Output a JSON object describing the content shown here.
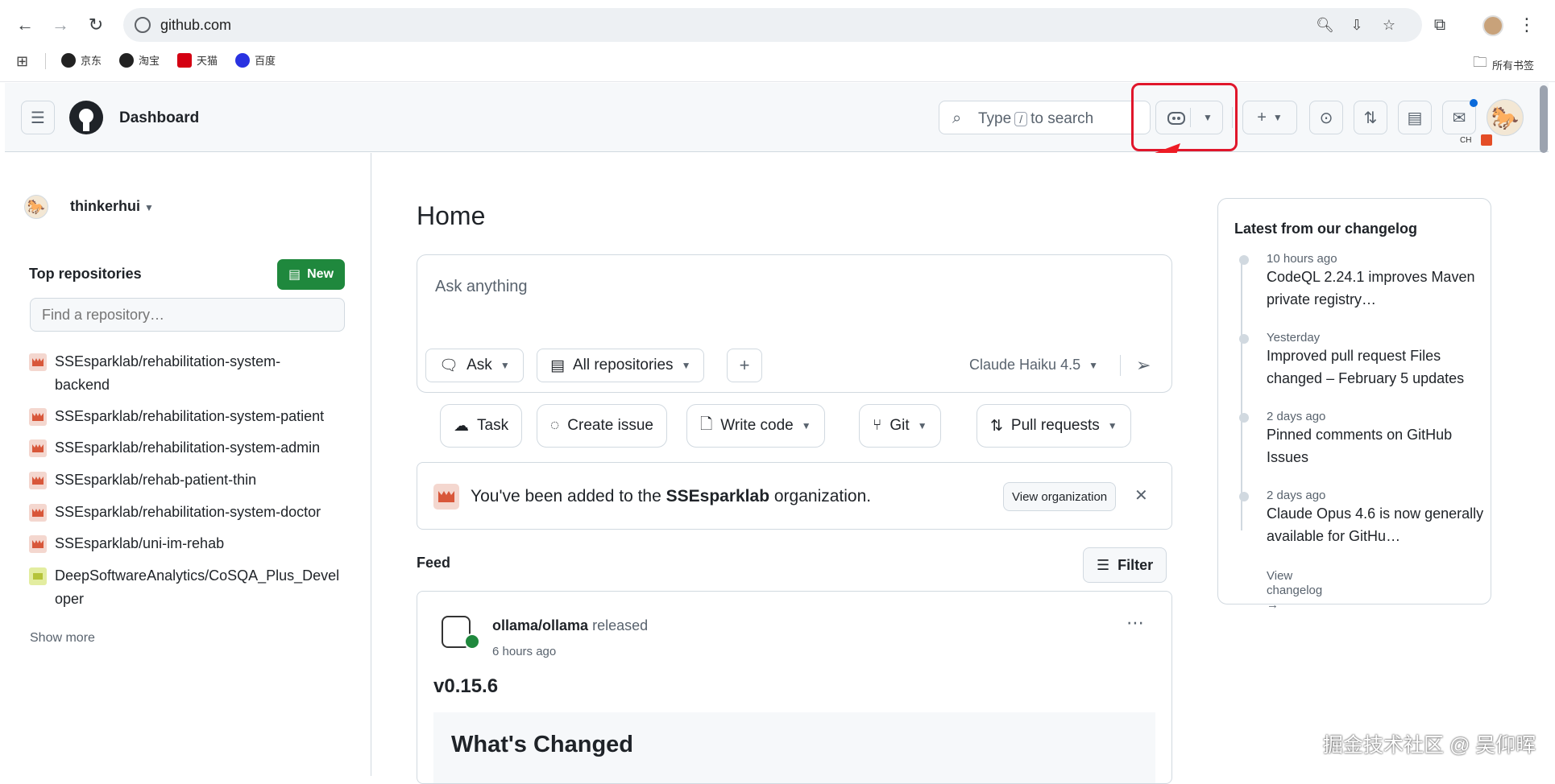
{
  "browser": {
    "url": "github.com",
    "bookmarks": [
      "京东",
      "淘宝",
      "天猫",
      "百度"
    ],
    "bookmarks_folder": "所有书签"
  },
  "header": {
    "title": "Dashboard",
    "search_prefix": "Type",
    "search_key": "/",
    "search_suffix": "to search"
  },
  "sidebar": {
    "username": "thinkerhui",
    "top_repos_heading": "Top repositories",
    "new_button": "New",
    "find_placeholder": "Find a repository…",
    "repos": [
      "SSEsparklab/rehabilitation-system-backend",
      "SSEsparklab/rehabilitation-system-patient",
      "SSEsparklab/rehabilitation-system-admin",
      "SSEsparklab/rehab-patient-thin",
      "SSEsparklab/rehabilitation-system-doctor",
      "SSEsparklab/uni-im-rehab",
      "DeepSoftwareAnalytics/CoSQA_Plus_Developer"
    ],
    "show_more": "Show more"
  },
  "main": {
    "home_title": "Home",
    "ask_placeholder": "Ask anything",
    "ask_mode": "Ask",
    "repo_scope": "All repositories",
    "model": "Claude Haiku 4.5",
    "actions": [
      "Task",
      "Create issue",
      "Write code",
      "Git",
      "Pull requests"
    ],
    "notice_prefix": "You've been added to the ",
    "notice_org": "SSEsparklab",
    "notice_suffix": " organization.",
    "view_org": "View organization",
    "feed_title": "Feed",
    "filter": "Filter",
    "feed_repo": "ollama/ollama",
    "feed_action": "released",
    "feed_time": "6 hours ago",
    "release_version": "v0.15.6",
    "whats_changed": "What's Changed"
  },
  "changelog": {
    "heading": "Latest from our changelog",
    "items": [
      {
        "time": "10 hours ago",
        "title": "CodeQL 2.24.1 improves Maven private registry…"
      },
      {
        "time": "Yesterday",
        "title": "Improved pull request Files changed – February 5 updates"
      },
      {
        "time": "2 days ago",
        "title": "Pinned comments on GitHub Issues"
      },
      {
        "time": "2 days ago",
        "title": "Claude Opus 4.6 is now generally available for GitHu…"
      }
    ],
    "view_link": "View changelog →"
  },
  "watermark": "掘金技术社区 @ 吴仰晖",
  "colors": {
    "accent_green": "#1f883d",
    "annotation_red": "#e0162b"
  }
}
